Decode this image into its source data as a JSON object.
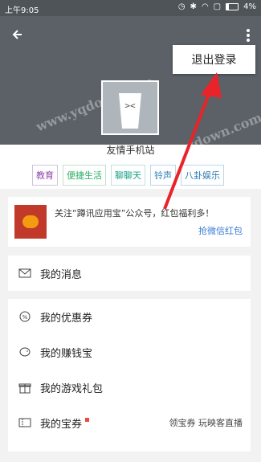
{
  "status_bar": {
    "time": "上午9:05",
    "battery": "4%"
  },
  "header": {
    "logout_label": "退出登录"
  },
  "profile": {
    "name": "友情手机站"
  },
  "tags": [
    "教育",
    "便捷生活",
    "聊聊天",
    "铃声",
    "八卦娱乐"
  ],
  "promo": {
    "text": "关注“蹲讯应用宝”公众号，红包福利多！",
    "link": "抢微信红包"
  },
  "menu_group1": [
    {
      "label": "我的消息"
    }
  ],
  "menu_group2": [
    {
      "label": "我的优惠券",
      "extra": ""
    },
    {
      "label": "我的赚钱宝",
      "extra": ""
    },
    {
      "label": "我的游戏礼包",
      "extra": ""
    },
    {
      "label": "我的宝券",
      "extra": "领宝券 玩映客直播"
    }
  ],
  "watermarks": [
    "www.yqdown.com",
    "www.yqdown.com",
    "www.yqdown.com"
  ],
  "colors": {
    "header_bg": "#5b6166",
    "arrow": "#e8242a",
    "link": "#3a7bd5",
    "badge_dot": "#e74c3c"
  }
}
